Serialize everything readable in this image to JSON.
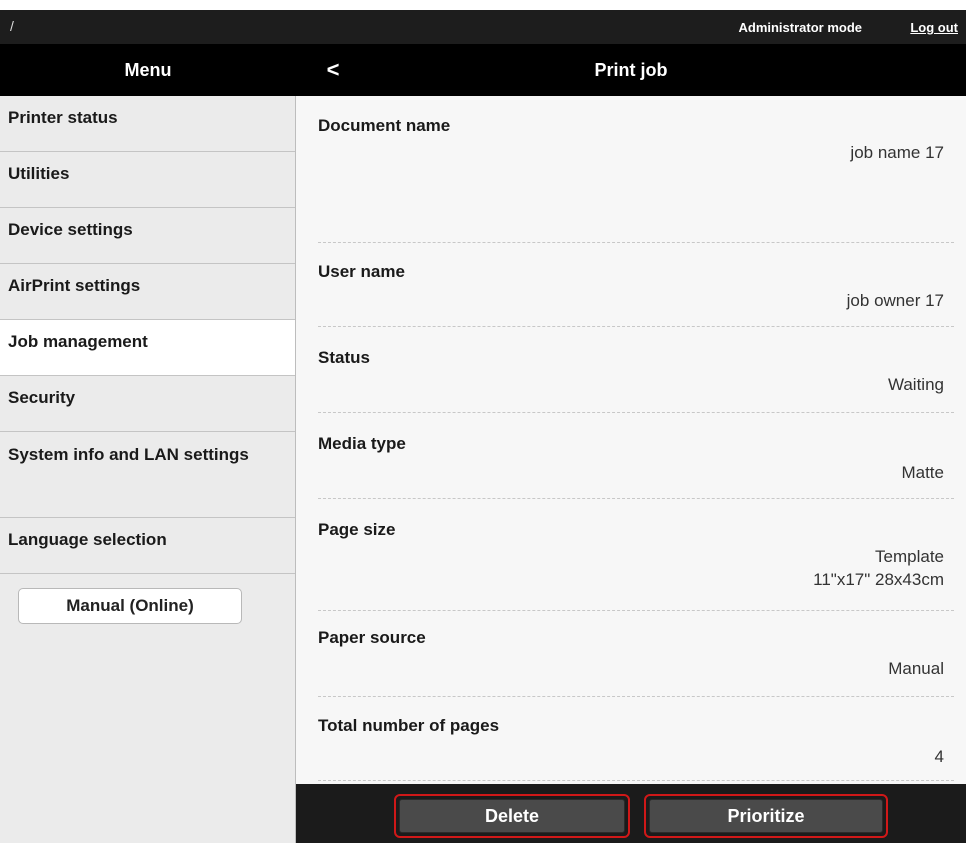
{
  "topbar": {
    "path": "/",
    "mode_label": "Administrator mode",
    "logout_label": "Log out"
  },
  "header": {
    "menu_title": "Menu",
    "page_title": "Print job",
    "back_icon": "<"
  },
  "sidebar": {
    "items": [
      {
        "label": "Printer status"
      },
      {
        "label": "Utilities"
      },
      {
        "label": "Device settings"
      },
      {
        "label": "AirPrint settings"
      },
      {
        "label": "Job management"
      },
      {
        "label": "Security"
      },
      {
        "label": "System info and LAN settings"
      },
      {
        "label": "Language selection"
      }
    ],
    "manual_button": "Manual (Online)"
  },
  "job": {
    "fields": [
      {
        "label": "Document name",
        "value": "job name 17"
      },
      {
        "label": "User name",
        "value": "job owner 17"
      },
      {
        "label": "Status",
        "value": "Waiting"
      },
      {
        "label": "Media type",
        "value": "Matte"
      },
      {
        "label": "Page size",
        "value": "Template",
        "value2": "11\"x17\" 28x43cm"
      },
      {
        "label": "Paper source",
        "value": "Manual"
      },
      {
        "label": "Total number of pages",
        "value": "4"
      }
    ]
  },
  "actions": {
    "delete_label": "Delete",
    "prioritize_label": "Prioritize"
  },
  "colors": {
    "highlight": "#d01818",
    "header_bg": "#000000",
    "sidebar_bg": "#ebebeb"
  }
}
